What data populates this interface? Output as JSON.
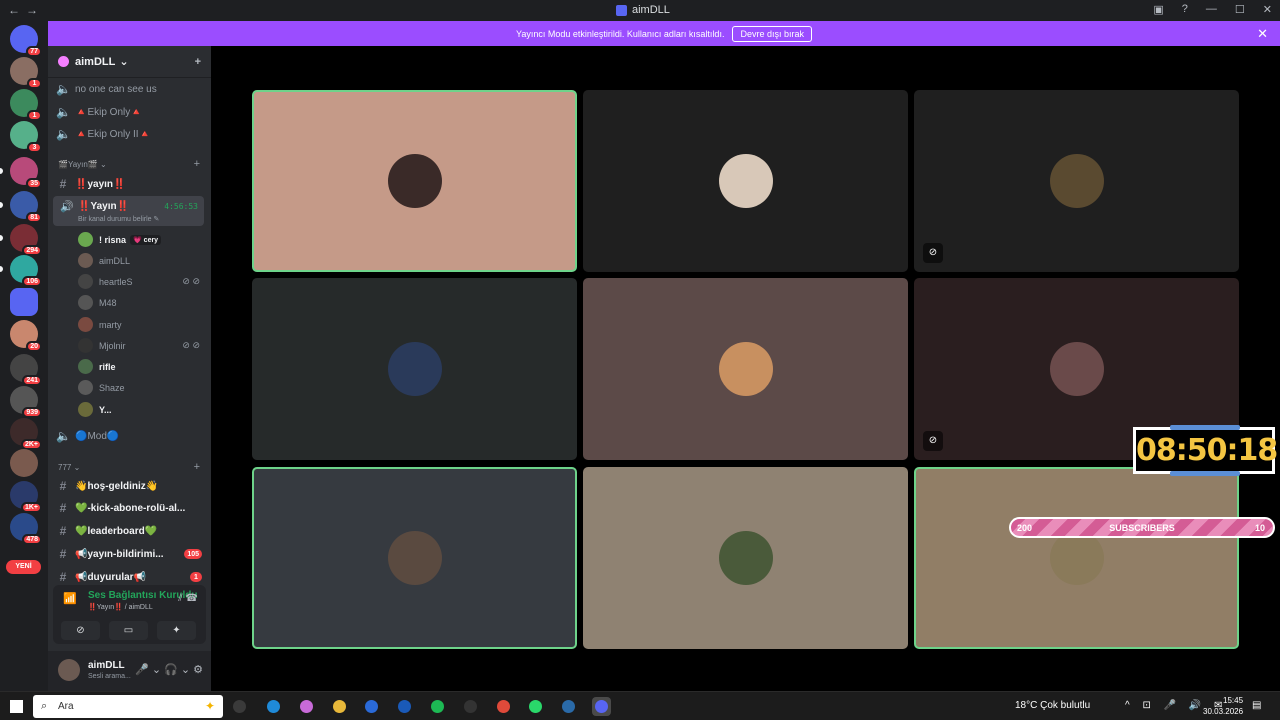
{
  "window": {
    "title": "aimDLL",
    "back_glyph": "←",
    "fwd_glyph": "→",
    "controls": [
      "▣",
      "?",
      "—",
      "☐",
      "✕"
    ]
  },
  "banner": {
    "text": "Yayıncı Modu etkinleştirildi. Kullanıcı adları kısaltıldı.",
    "button": "Devre dışı bırak",
    "close": "✕",
    "color": "#9b4dff"
  },
  "guilds": [
    {
      "badge": "77",
      "color": "#5865f2"
    },
    {
      "badge": "1",
      "color": "#8a6e63"
    },
    {
      "badge": "1",
      "color": "#3c8a5d"
    },
    {
      "badge": "3",
      "color": "#56b08a"
    },
    {
      "badge": "35",
      "color": "#b84a7a"
    },
    {
      "badge": "81",
      "color": "#3a5ba8"
    },
    {
      "badge": "294",
      "color": "#7a2d35"
    },
    {
      "badge": "106",
      "color": "#2fa8a0"
    },
    {
      "badge": "",
      "color": "#5865f2"
    },
    {
      "badge": "20",
      "color": "#c9876e"
    },
    {
      "badge": "241",
      "color": "#444"
    },
    {
      "badge": "939",
      "color": "#555"
    },
    {
      "badge": "2K+",
      "color": "#3d2a2a"
    },
    {
      "badge": "",
      "color": "#7a5a4e"
    },
    {
      "badge": "1K+",
      "color": "#2a3a6a"
    },
    {
      "badge": "478",
      "color": "#2a4a8a"
    }
  ],
  "yeni_label": "YENİ",
  "server": {
    "name": "aimDLL",
    "chevron": "⌄",
    "invite_icon": "+"
  },
  "channels": {
    "voice_top": [
      {
        "label": "no one can see us",
        "icon": "🔊"
      },
      {
        "label": "🔺Ekip Only🔺",
        "icon": "🔊"
      },
      {
        "label": "🔺Ekip Only II🔺",
        "icon": "🔊"
      }
    ],
    "cat1": "🎬Yayın🎬",
    "text1": {
      "label": "‼️yayın‼️",
      "icon": "#"
    },
    "active": {
      "label": "‼️Yayın‼️",
      "timer": "4:56:53",
      "status": "Bir kanal durumu belirle ✎",
      "icon": "🔊"
    },
    "members": [
      {
        "name": "! risna",
        "tag": "💗 cery",
        "bright": true,
        "icons": "",
        "color": "#6aa84f"
      },
      {
        "name": "aimDLL",
        "tag": "",
        "bright": false,
        "icons": "",
        "color": "#6b5a52"
      },
      {
        "name": "heartleS",
        "tag": "",
        "bright": false,
        "icons": "⊘ ⊘",
        "color": "#444"
      },
      {
        "name": "M48",
        "tag": "",
        "bright": false,
        "icons": "",
        "color": "#555"
      },
      {
        "name": "marty",
        "tag": "",
        "bright": false,
        "icons": "",
        "color": "#7a4a40"
      },
      {
        "name": "Mjolnir",
        "tag": "",
        "bright": false,
        "icons": "⊘ ⊘",
        "color": "#333"
      },
      {
        "name": "rifle",
        "tag": "",
        "bright": true,
        "icons": "",
        "color": "#4a6a4a"
      },
      {
        "name": "Shaze",
        "tag": "",
        "bright": false,
        "icons": "",
        "color": "#5a5a5a"
      },
      {
        "name": "Y...",
        "tag": "",
        "bright": true,
        "icons": "",
        "color": "#6a6a3a"
      }
    ],
    "mod": {
      "label": "🔵Mod🔵",
      "icon": "🔊"
    },
    "cat2": "777",
    "text2": [
      {
        "label": "👋hoş-geldiniz👋",
        "badge": ""
      },
      {
        "label": "💚-kick-abone-rolü-al...",
        "badge": ""
      },
      {
        "label": "💚leaderboard💚",
        "badge": ""
      },
      {
        "label": "📢yayın-bildirimi...",
        "badge": "105"
      },
      {
        "label": "📢duyurular📢",
        "badge": "1"
      }
    ]
  },
  "voice_panel": {
    "title": "Ses Bağlantısı Kuruldu",
    "subtitle": "‼️Yayın‼️ / aimDLL",
    "buttons": [
      "⊘",
      "▭",
      "✦",
      "✺"
    ],
    "signal": "📶",
    "right_icons": "⫽ ☎"
  },
  "user_panel": {
    "name": "aimDLL",
    "status": "Sesli arama...",
    "controls": "🎤 ⌄ 🎧 ⌄ ⚙"
  },
  "tiles": [
    {
      "bg": "#c59a88",
      "avatar": "#3a2a28",
      "speaking": true,
      "mute": false
    },
    {
      "bg": "#1f1f1f",
      "avatar": "#d8c8b8",
      "speaking": false,
      "mute": false
    },
    {
      "bg": "#1f1f1f",
      "avatar": "#5a4a30",
      "speaking": false,
      "mute": true
    },
    {
      "bg": "#262a2a",
      "avatar": "#2a3a5a",
      "speaking": false,
      "mute": false
    },
    {
      "bg": "#5c4a48",
      "avatar": "#c89060",
      "speaking": false,
      "mute": false
    },
    {
      "bg": "#2a1e1f",
      "avatar": "#6a4a4a",
      "speaking": false,
      "mute": true
    },
    {
      "bg": "#363a40",
      "avatar": "#5a4a40",
      "speaking": true,
      "mute": false
    },
    {
      "bg": "#8f8272",
      "avatar": "#4a5a3a",
      "speaking": false,
      "mute": false
    },
    {
      "bg": "#917e66",
      "avatar": "#8a7a5a",
      "speaking": true,
      "mute": false
    }
  ],
  "overlay": {
    "timer": "08:50:18",
    "subs_left": "200",
    "subs_label": "SUBSCRIBERS",
    "subs_right": "10"
  },
  "taskbar": {
    "search_placeholder": "Ara",
    "search_icon": "⌕",
    "weather": "18°C  Çok bulutlu",
    "tray": "^ ⊡ 🎤 🔊 ✉",
    "time": "15:45",
    "date": "30.03.2026",
    "notif": "▤",
    "apps": [
      {
        "name": "task-view",
        "color": "#3a3a3a",
        "active": false
      },
      {
        "name": "edge",
        "color": "#1f8ad8",
        "active": false
      },
      {
        "name": "copilot",
        "color": "#c86ad8",
        "active": false
      },
      {
        "name": "explorer",
        "color": "#e8b83a",
        "active": false
      },
      {
        "name": "store",
        "color": "#2a6ad8",
        "active": false
      },
      {
        "name": "outlook",
        "color": "#1a5ab8",
        "active": false
      },
      {
        "name": "spotify",
        "color": "#1db954",
        "active": false
      },
      {
        "name": "app7",
        "color": "#333",
        "active": false
      },
      {
        "name": "chrome",
        "color": "#e04a3a",
        "active": false
      },
      {
        "name": "app9",
        "color": "#2ad86a",
        "active": false
      },
      {
        "name": "app10",
        "color": "#2a6aa8",
        "active": false
      },
      {
        "name": "discord",
        "color": "#5865f2",
        "active": true
      }
    ]
  }
}
